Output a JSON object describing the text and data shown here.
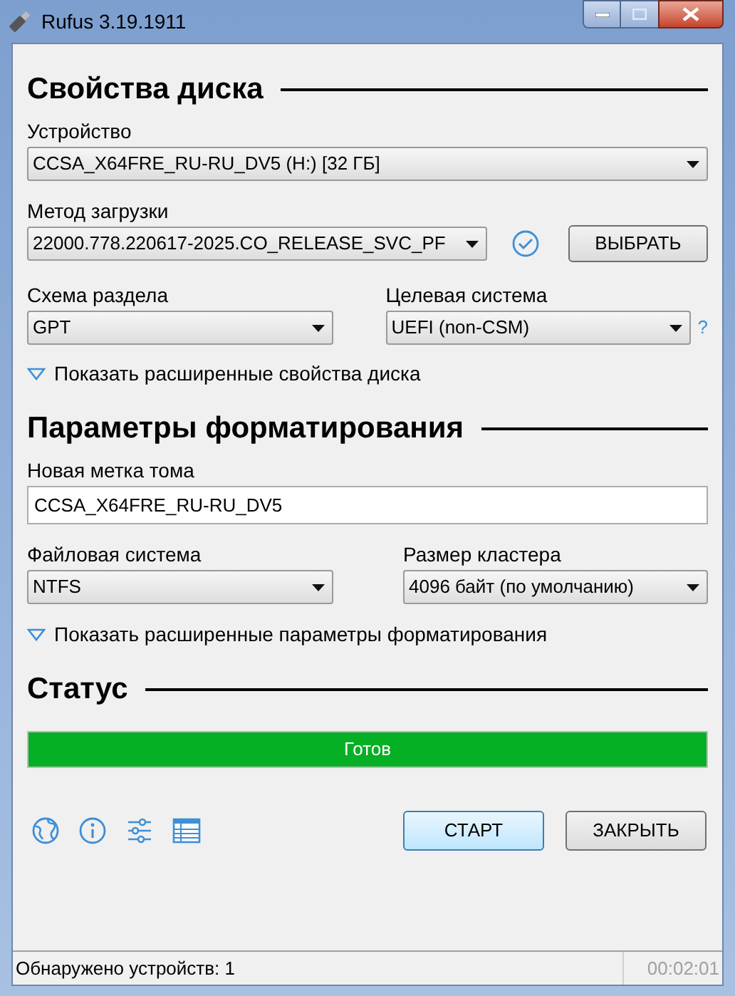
{
  "window": {
    "title": "Rufus 3.19.1911"
  },
  "drive_properties": {
    "heading": "Свойства диска",
    "device": {
      "label": "Устройство",
      "value": "CCSA_X64FRE_RU-RU_DV5 (H:) [32 ГБ]"
    },
    "boot_selection": {
      "label": "Метод загрузки",
      "value": "22000.778.220617-2025.CO_RELEASE_SVC_PF",
      "select_button": "ВЫБРАТЬ"
    },
    "partition_scheme": {
      "label": "Схема раздела",
      "value": "GPT"
    },
    "target_system": {
      "label": "Целевая система",
      "value": "UEFI (non-CSM)",
      "help": "?"
    },
    "advanced_toggle": {
      "label": "Показать расширенные свойства диска",
      "expanded": false
    }
  },
  "format_options": {
    "heading": "Параметры форматирования",
    "volume_label": {
      "label": "Новая метка тома",
      "value": "CCSA_X64FRE_RU-RU_DV5"
    },
    "file_system": {
      "label": "Файловая система",
      "value": "NTFS"
    },
    "cluster_size": {
      "label": "Размер кластера",
      "value": "4096 байт (по умолчанию)"
    },
    "advanced_toggle": {
      "label": "Показать расширенные параметры форматирования",
      "expanded": false
    }
  },
  "status": {
    "heading": "Статус",
    "progress": {
      "text": "Готов",
      "level": 1
    }
  },
  "buttons": {
    "start": "СТАРТ",
    "close": "ЗАКРЫТЬ"
  },
  "status_bar": {
    "message": "Обнаружено устройств: 1",
    "timer": "00:02:01"
  }
}
